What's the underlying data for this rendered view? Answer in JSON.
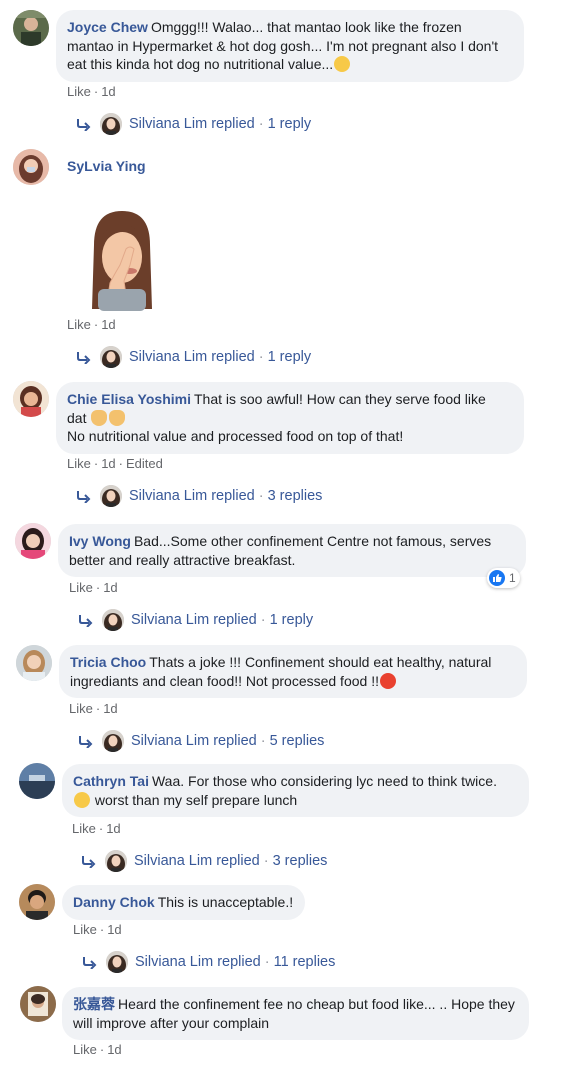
{
  "comments": [
    {
      "name": "Joyce Chew",
      "text": "Omggg!!! Walao... that mantao look like the frozen mantao in Hypermarket & hot dog gosh... I'm not pregnant also I don't eat this kinda hot dog no nutritional value...",
      "like": "Like",
      "time": "1d",
      "reply_name": "Silviana Lim replied",
      "reply_count": "1 reply"
    },
    {
      "name": "SyLvia Ying",
      "like": "Like",
      "time": "1d",
      "reply_name": "Silviana Lim replied",
      "reply_count": "1 reply"
    },
    {
      "name": "Chie Elisa Yoshimi",
      "text_line1": "That is soo awful! How can they serve food like",
      "text_line2": "dat",
      "text_line3": "No nutritional value and processed food on top of that!",
      "like": "Like",
      "time": "1d",
      "edited": "Edited",
      "reply_name": "Silviana Lim replied",
      "reply_count": "3 replies"
    },
    {
      "name": "Ivy Wong",
      "text": "Bad...Some other confinement Centre not famous, serves better and really attractive breakfast.",
      "like": "Like",
      "time": "1d",
      "reaction_count": "1",
      "reply_name": "Silviana Lim replied",
      "reply_count": "1 reply"
    },
    {
      "name": "Tricia Choo",
      "text": "Thats a joke !!! Confinement should eat healthy, natural ingrediants and clean food!! Not processed food !!",
      "like": "Like",
      "time": "1d",
      "reply_name": "Silviana Lim replied",
      "reply_count": "5 replies"
    },
    {
      "name": "Cathryn Tai",
      "text_line1": "Waa. For those who considering lyc need to think twice.",
      "text_line2": "worst than my self prepare lunch",
      "like": "Like",
      "time": "1d",
      "reply_name": "Silviana Lim replied",
      "reply_count": "3 replies"
    },
    {
      "name": "Danny Chok",
      "text": "This is unacceptable.!",
      "like": "Like",
      "time": "1d",
      "reply_name": "Silviana Lim replied",
      "reply_count": "11 replies"
    },
    {
      "name": "张嘉蓉",
      "text": "Heard the confinement fee no cheap but food like... .. Hope they will improve after your complain",
      "like": "Like",
      "time": "1d"
    }
  ],
  "colors": {
    "name": "#385898",
    "bubble": "#f0f2f5",
    "meta": "#65676b"
  },
  "icons": [
    "reply-arrow-icon",
    "sad-emoji-icon",
    "angry-emoji-icon",
    "facepalm-woman-emoji-icon",
    "rofl-emoji-icon",
    "like-reaction-icon"
  ]
}
